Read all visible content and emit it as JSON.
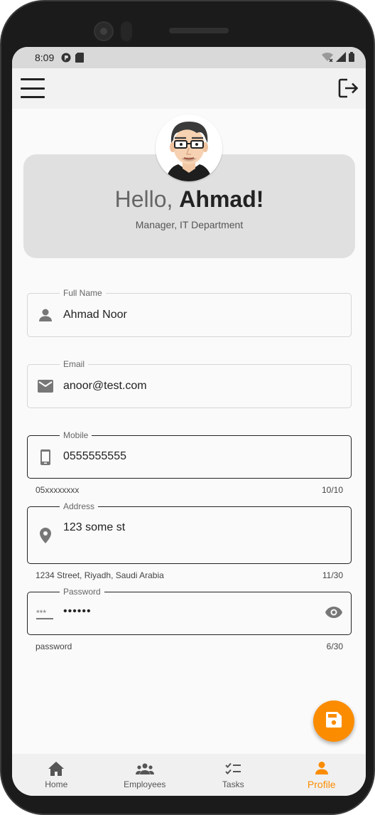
{
  "status_bar": {
    "time": "8:09"
  },
  "app_bar": {
    "menu_icon": "hamburger-menu-icon",
    "logout_icon": "logout-icon"
  },
  "header": {
    "greeting": "Hello,",
    "user_name": "Ahmad!",
    "role": "Manager, IT Department"
  },
  "form": {
    "full_name": {
      "label": "Full Name",
      "value": "Ahmad Noor",
      "icon": "person-icon"
    },
    "email": {
      "label": "Email",
      "value": "anoor@test.com",
      "icon": "mail-icon"
    },
    "mobile": {
      "label": "Mobile",
      "value": "0555555555",
      "helper": "05xxxxxxxx",
      "counter": "10/10",
      "icon": "phone-icon"
    },
    "address": {
      "label": "Address",
      "value": "123 some st",
      "helper": "1234 Street, Riyadh, Saudi Arabia",
      "counter": "11/30",
      "icon": "location-pin-icon"
    },
    "password": {
      "label": "Password",
      "value": "••••••",
      "helper": "password",
      "counter": "6/30",
      "icon": "password-icon"
    }
  },
  "fab": {
    "icon": "save-icon"
  },
  "bottom_nav": {
    "items": [
      {
        "label": "Home",
        "icon": "home-icon"
      },
      {
        "label": "Employees",
        "icon": "group-icon"
      },
      {
        "label": "Tasks",
        "icon": "checklist-icon"
      },
      {
        "label": "Profile",
        "icon": "person-icon",
        "active": true
      }
    ]
  },
  "colors": {
    "accent": "#fb8c00",
    "card": "#e0e0e0",
    "background": "#fafafa"
  }
}
